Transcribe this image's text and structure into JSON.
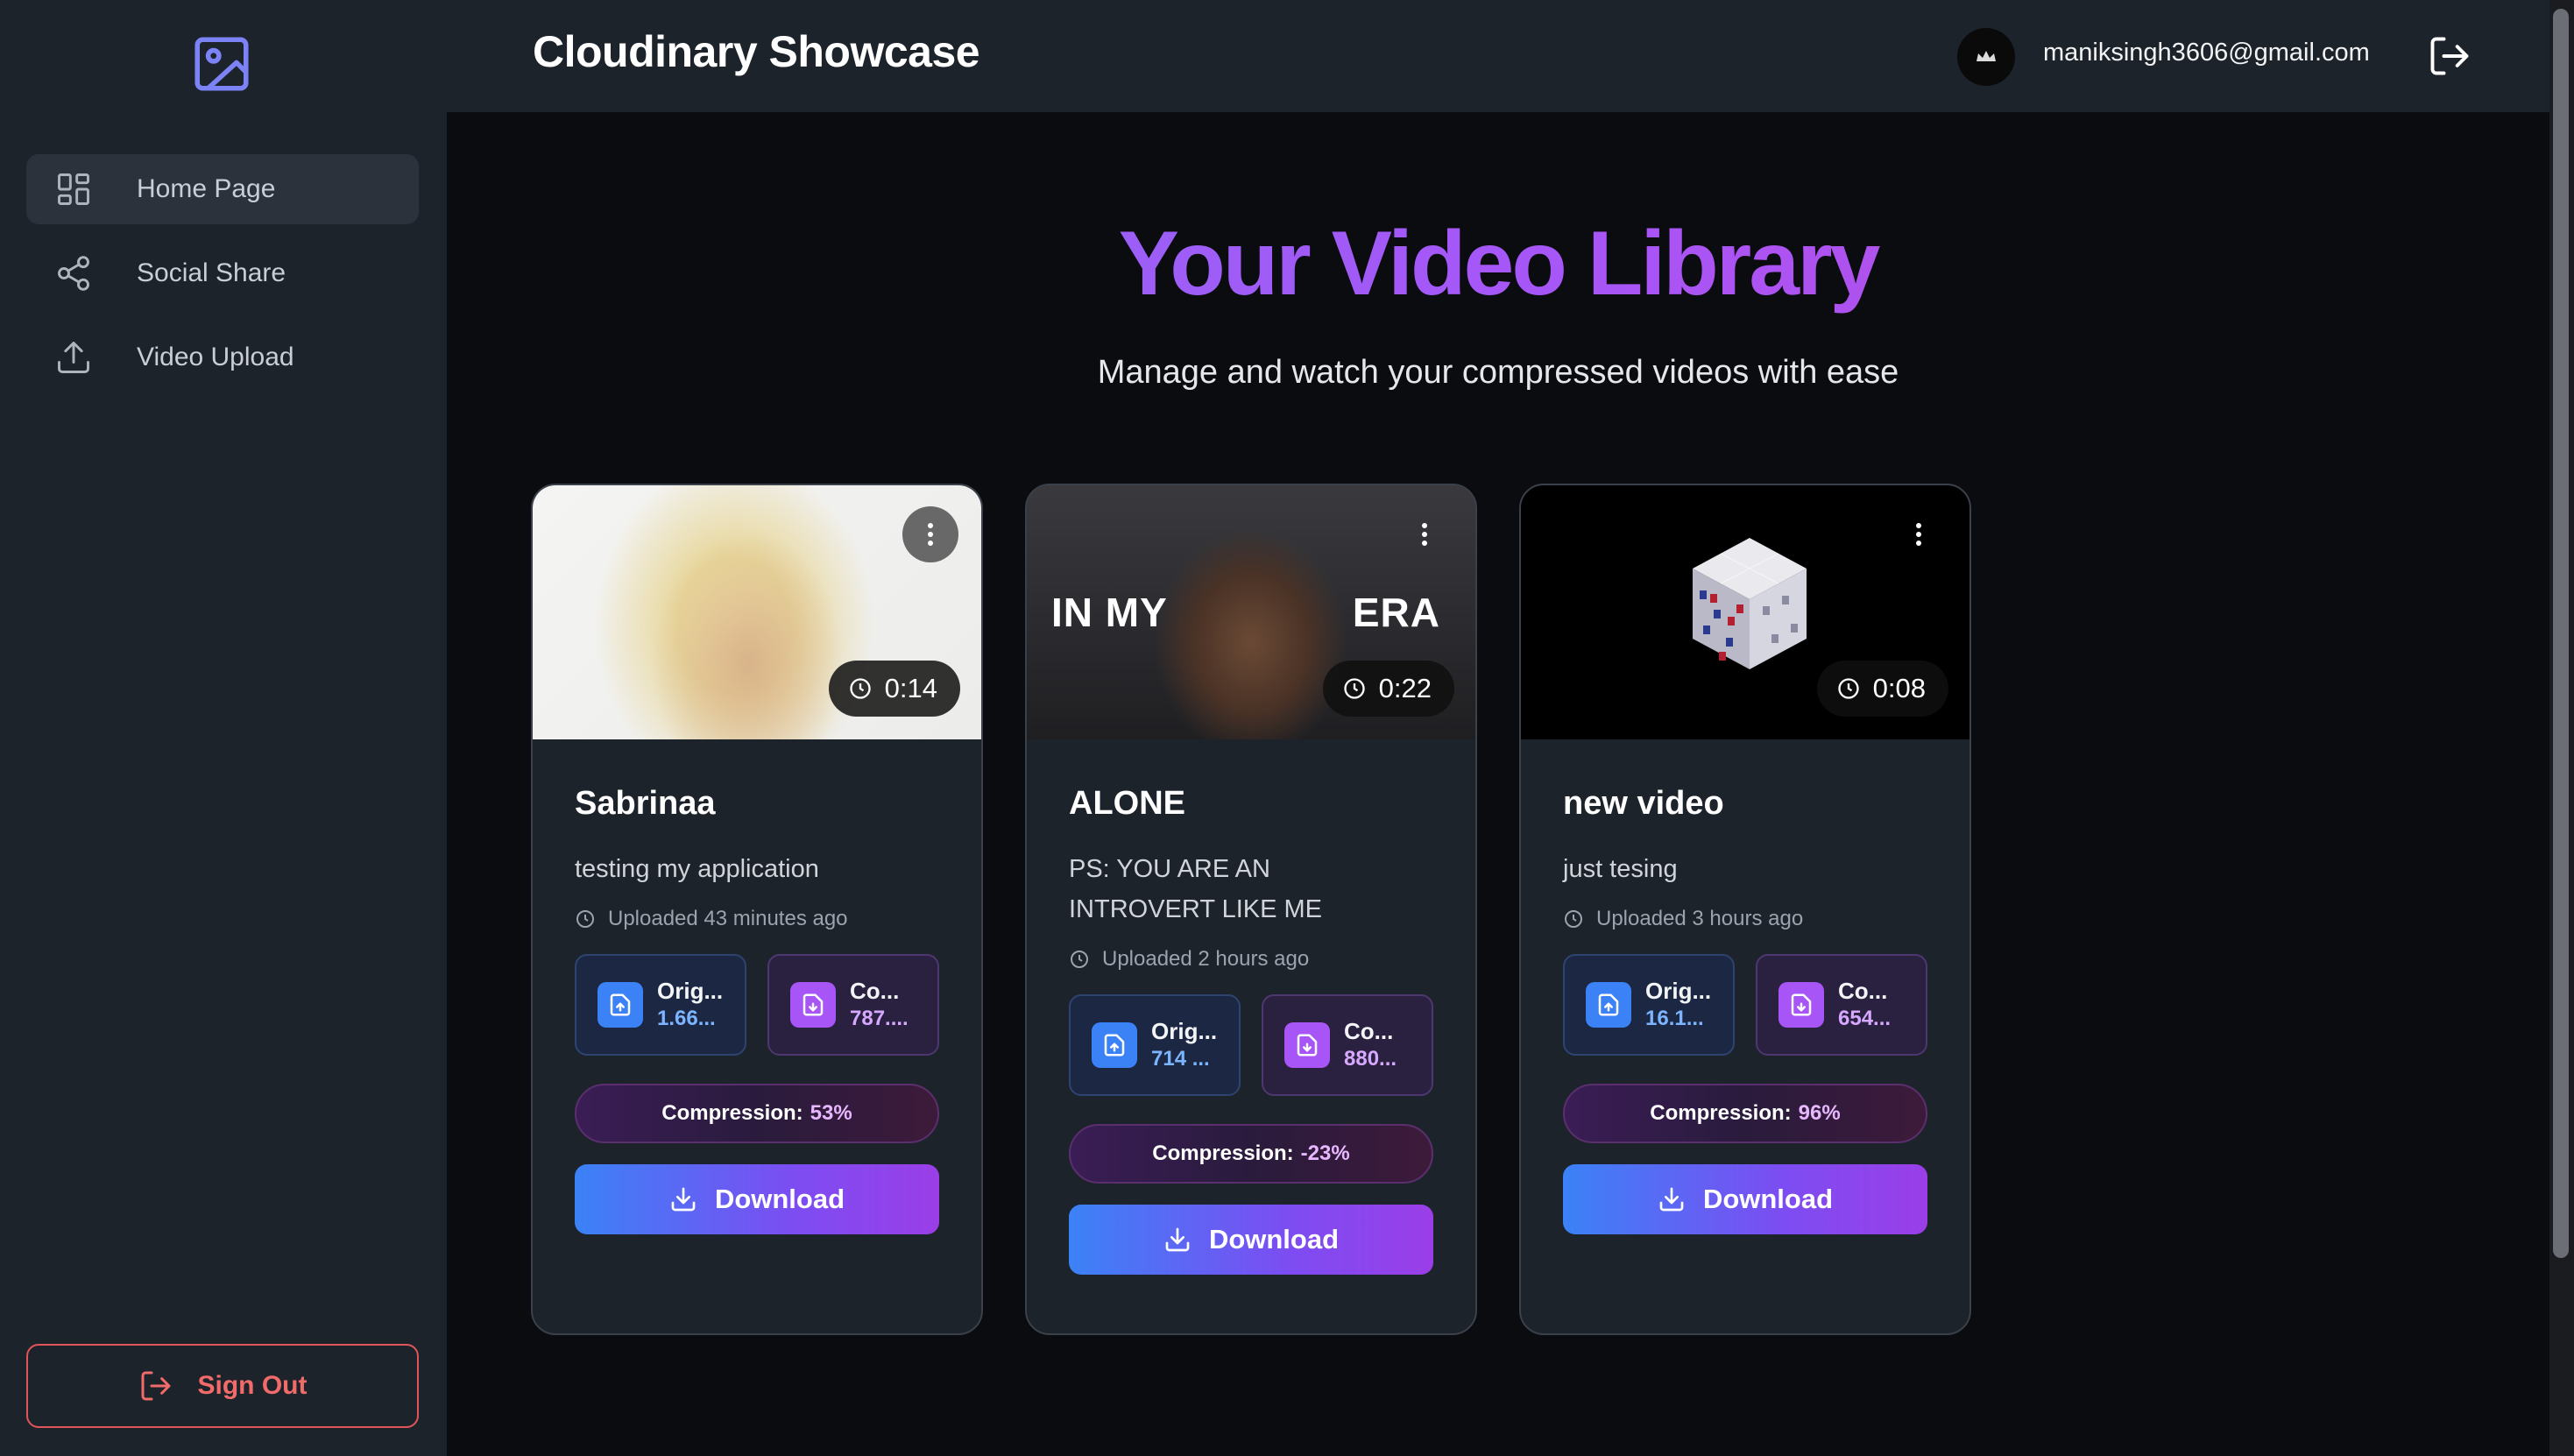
{
  "brand": {
    "accent": "#8b6cf6",
    "danger": "#f26b6b"
  },
  "sidebar": {
    "items": [
      {
        "label": "Home Page",
        "icon": "grid-icon",
        "active": true
      },
      {
        "label": "Social Share",
        "icon": "share-icon",
        "active": false
      },
      {
        "label": "Video Upload",
        "icon": "upload-icon",
        "active": false
      }
    ],
    "signout_label": "Sign Out"
  },
  "header": {
    "title": "Cloudinary Showcase",
    "email": "maniksingh3606@gmail.com"
  },
  "hero": {
    "title": "Your Video Library",
    "subtitle": "Manage and watch your compressed videos with ease"
  },
  "videos": [
    {
      "title": "Sabrinaa",
      "description": "testing my application",
      "duration": "0:14",
      "uploaded": "Uploaded 43 minutes ago",
      "original_label": "Orig...",
      "original_value": "1.66...",
      "compressed_label": "Co...",
      "compressed_value": "787....",
      "compression_label": "Compression:",
      "compression_value": "53%",
      "download_label": "Download"
    },
    {
      "title": "ALONE",
      "description": "PS: YOU ARE AN INTROVERT LIKE ME",
      "duration": "0:22",
      "thumb_text_left": "IN MY",
      "thumb_text_right": "ERA",
      "uploaded": "Uploaded 2 hours ago",
      "original_label": "Orig...",
      "original_value": "714 ...",
      "compressed_label": "Co...",
      "compressed_value": "880...",
      "compression_label": "Compression:",
      "compression_value": "-23%",
      "download_label": "Download"
    },
    {
      "title": "new video",
      "description": "just tesing",
      "duration": "0:08",
      "uploaded": "Uploaded 3 hours ago",
      "original_label": "Orig...",
      "original_value": "16.1...",
      "compressed_label": "Co...",
      "compressed_value": "654...",
      "compression_label": "Compression:",
      "compression_value": "96%",
      "download_label": "Download"
    }
  ]
}
